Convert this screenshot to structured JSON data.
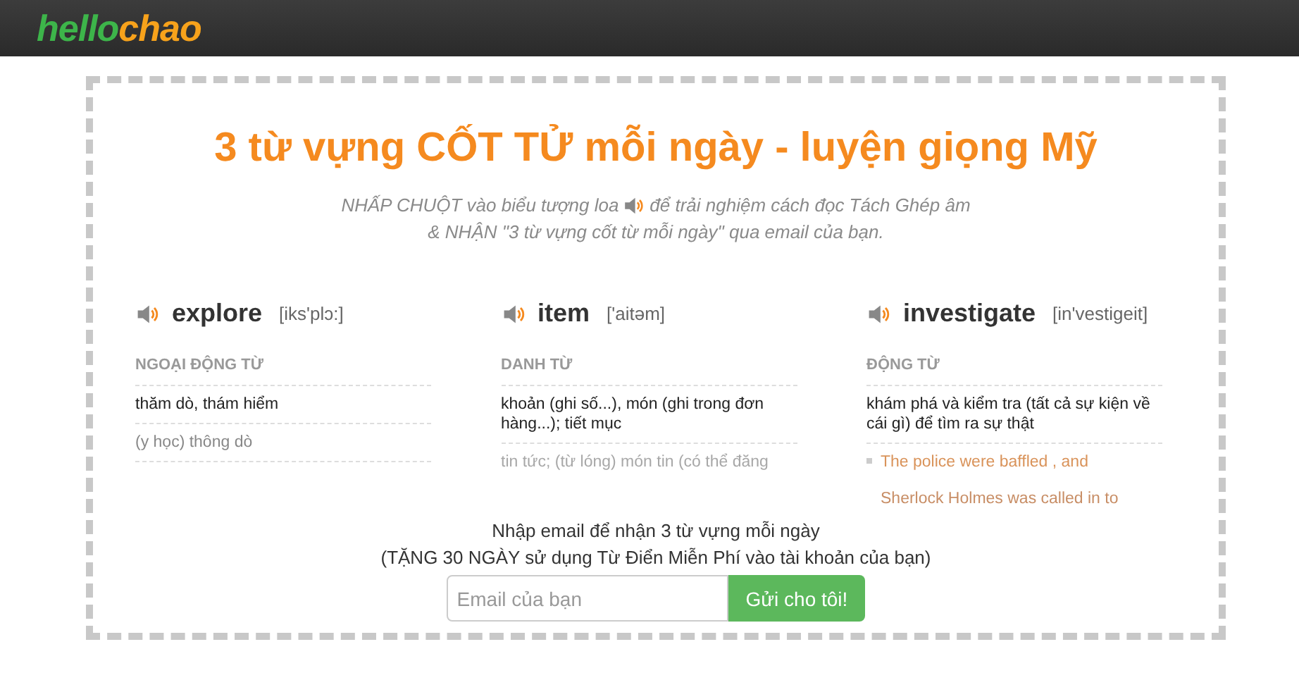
{
  "logo": {
    "part_1": "hello",
    "part_2": "chao"
  },
  "title": "3 từ vựng CỐT TỬ mỗi ngày - luyện giọng Mỹ",
  "subtitle": {
    "before_icon": "NHẤP CHUỘT vào biểu tượng loa",
    "after_icon": "để trải nghiệm cách đọc Tách Ghép âm",
    "line_2": "& NHẬN \"3 từ vựng cốt từ mỗi ngày\" qua email của bạn."
  },
  "words": [
    {
      "word": "explore",
      "phonetic": "[iks'plɔ:]",
      "part_of_speech": "NGOẠI ĐỘNG TỪ",
      "meanings": [
        {
          "kind": "meaning",
          "text": "thăm dò, thám hiểm"
        },
        {
          "kind": "faded",
          "text": "(y học) thông dò"
        }
      ]
    },
    {
      "word": "item",
      "phonetic": "['aitəm]",
      "part_of_speech": "DANH TỪ",
      "meanings": [
        {
          "kind": "meaning",
          "text": "khoản (ghi số...), món (ghi trong đơn hàng...); tiết mục"
        },
        {
          "kind": "faint",
          "text": "tin tức; (từ lóng) món tin (có thể đăng"
        }
      ]
    },
    {
      "word": "investigate",
      "phonetic": "[in'vestigeit]",
      "part_of_speech": "ĐỘNG TỪ",
      "meanings": [
        {
          "kind": "meaning",
          "text": "khám phá và kiểm tra (tất cả sự kiện về cái gì) để tìm ra sự thật"
        },
        {
          "kind": "example",
          "text": "The police were baffled , and"
        },
        {
          "kind": "faint-example",
          "text": "Sherlock Holmes was called in to"
        }
      ]
    }
  ],
  "signup": {
    "line_1": "Nhập email để nhận 3 từ vựng mỗi ngày",
    "line_2": "(TẶNG 30 NGÀY sử dụng Từ Điển Miễn Phí vào tài khoản của bạn)",
    "placeholder": "Email của bạn",
    "button": "Gửi cho tôi!"
  }
}
